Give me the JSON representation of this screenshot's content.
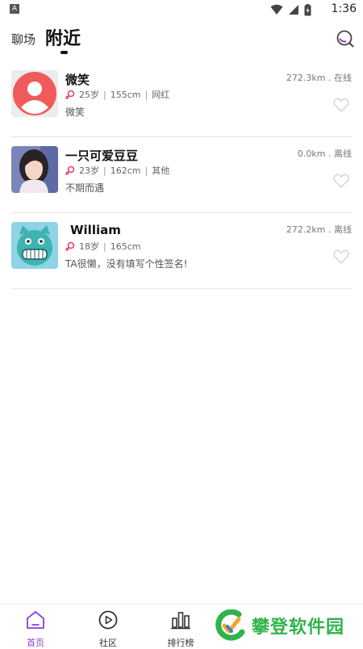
{
  "status_bar": {
    "left_badge": "A",
    "time": "1:36"
  },
  "header": {
    "tab_plaza": "聊场",
    "tab_nearby": "附近"
  },
  "users": [
    {
      "name": "微笑",
      "age": "25岁",
      "height": "155cm",
      "tag": "网红",
      "signature": "微笑",
      "distance": "272.3km . 在线",
      "avatar_icon": "default-avatar-icon"
    },
    {
      "name": "一只可爱豆豆",
      "age": "23岁",
      "height": "162cm",
      "tag": "其他",
      "signature": "不期而遇",
      "distance": "0.0km . 离线",
      "avatar_icon": "photo-avatar"
    },
    {
      "name": "William",
      "age": "18岁",
      "height": "165cm",
      "tag": "",
      "signature": "TA很懒，没有填写个性签名!",
      "distance": "272.2km . 离线",
      "avatar_icon": "cartoon-cat-avatar"
    }
  ],
  "bottom_nav": {
    "home": "首页",
    "community": "社区",
    "ranking": "排行榜"
  },
  "watermark": {
    "text": "攀登软件园"
  },
  "colors": {
    "accent": "#8a3fd6",
    "female_icon": "#e0407a",
    "watermark_green": "#2fb34a"
  }
}
